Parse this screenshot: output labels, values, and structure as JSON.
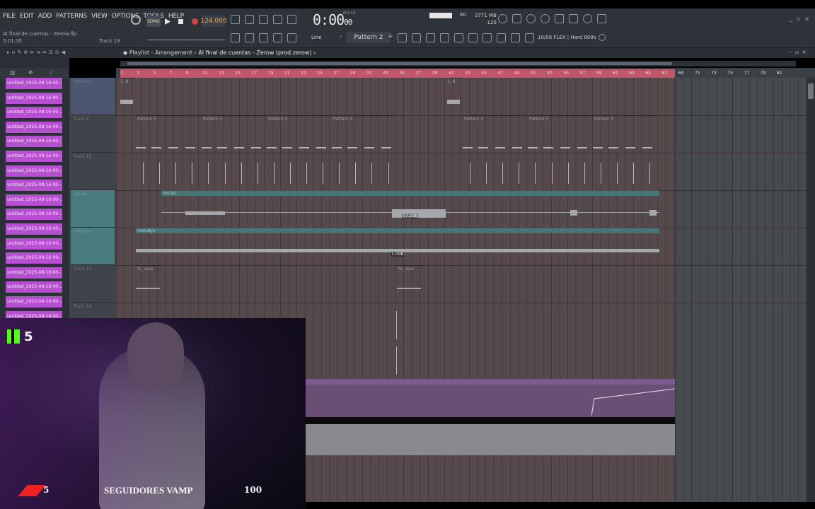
{
  "menu": [
    "FILE",
    "EDIT",
    "ADD",
    "PATTERNS",
    "VIEW",
    "OPTIONS",
    "TOOLS",
    "HELP"
  ],
  "project": {
    "file_title": "Al final de cuentas - Zerow.flp",
    "time_small": "2:01:35",
    "track_hint": "Track 19"
  },
  "transport": {
    "song_label": "SONG",
    "tempo": "124.000",
    "clock_main": "0:00",
    "clock_sub": "00",
    "clock_unit": "M:S:CS"
  },
  "monitor": {
    "cpu": "60",
    "memory": "3771 MB",
    "polyphony": "120"
  },
  "toolbar": {
    "snap_label": "Line",
    "pattern_label": "Pattern 2",
    "plugin_label": "10/06  FLEX | Hard 808s"
  },
  "playlist": {
    "title_prefix": "Playlist - Arrangement",
    "song_name": "Al final de cuentas - Zerow (prod.zerow)",
    "ruler": [
      "1",
      "3",
      "5",
      "7",
      "9",
      "11",
      "13",
      "15",
      "17",
      "19",
      "21",
      "23",
      "25",
      "27",
      "29",
      "31",
      "33",
      "35",
      "37",
      "39",
      "41",
      "43",
      "45",
      "47",
      "49",
      "51",
      "53",
      "55",
      "57",
      "59",
      "61",
      "63",
      "65",
      "67",
      "69",
      "71",
      "73",
      "75",
      "77",
      "79",
      "81"
    ]
  },
  "picker": {
    "items": [
      "untitled_2025-08-16 00-...",
      "untitled_2025-08-16 00-...",
      "untitled_2025-08-16 00-...",
      "untitled_2025-08-16 00-...",
      "untitled_2025-08-16 00-...",
      "untitled_2025-08-16 00-...",
      "untitled_2025-08-16 00-...",
      "untitled_2025-08-16 00-...",
      "untitled_2025-08-16 00-...",
      "untitled_2025-08-16 00-...",
      "untitled_2025-08-16 00-...",
      "untitled_2025-08-16 00-...",
      "untitled_2025-08-16 00-...",
      "untitled_2025-08-16 00-...",
      "untitled_2025-08-16 00-...",
      "untitled_2025-08-16 00-...",
      "untitled_2025-08-16 00-..."
    ]
  },
  "tracks": {
    "t1": "Sampler",
    "t2": "Track 9",
    "t3": "Track 10",
    "t4": "vocals",
    "t5": "melodys",
    "t6": "Track 13",
    "t7": "Track 14"
  },
  "clips": {
    "pattern": "Pattern 5",
    "vocals": "vocals",
    "melodys": "melodys",
    "fx": "fx_.wav",
    "small": "1..8",
    "vocals_db": "17.2dB",
    "melodys_db": "1.0dB"
  },
  "stream": {
    "kick_count": "5",
    "goal_current": "5",
    "goal_text": "SEGUIDORES VAMP",
    "goal_target": "100"
  }
}
